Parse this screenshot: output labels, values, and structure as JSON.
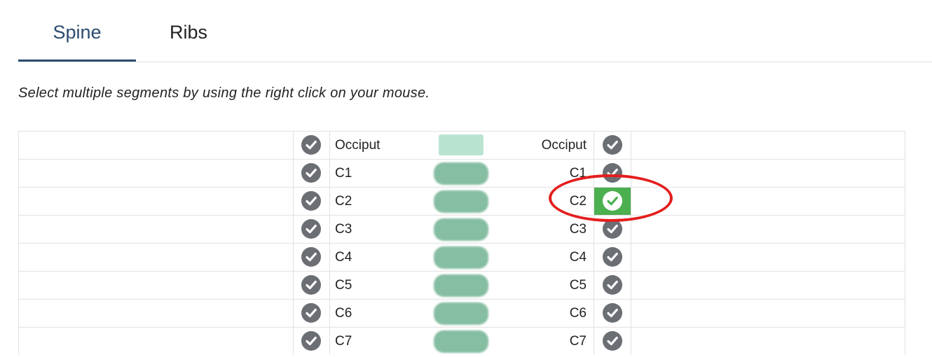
{
  "tabs": [
    {
      "label": "Spine",
      "active": true
    },
    {
      "label": "Ribs",
      "active": false
    }
  ],
  "instruction": "Select multiple segments by using the right click on your mouse.",
  "segments": [
    {
      "left_label": "Occiput",
      "right_label": "Occiput",
      "right_selected": false
    },
    {
      "left_label": "C1",
      "right_label": "C1",
      "right_selected": false
    },
    {
      "left_label": "C2",
      "right_label": "C2",
      "right_selected": true
    },
    {
      "left_label": "C3",
      "right_label": "C3",
      "right_selected": false
    },
    {
      "left_label": "C4",
      "right_label": "C4",
      "right_selected": false
    },
    {
      "left_label": "C5",
      "right_label": "C5",
      "right_selected": false
    },
    {
      "left_label": "C6",
      "right_label": "C6",
      "right_selected": false
    },
    {
      "left_label": "C7",
      "right_label": "C7",
      "right_selected": false
    }
  ],
  "colors": {
    "accent": "#2b4c6f",
    "check_gray": "#6b6f74",
    "selected_green": "#4caf50",
    "vertebra_green": "#86bea3",
    "annotation_red": "#e41d1d"
  },
  "icons": {
    "row_check": "check-circle-icon",
    "vertebra": "vertebra-graphic"
  }
}
